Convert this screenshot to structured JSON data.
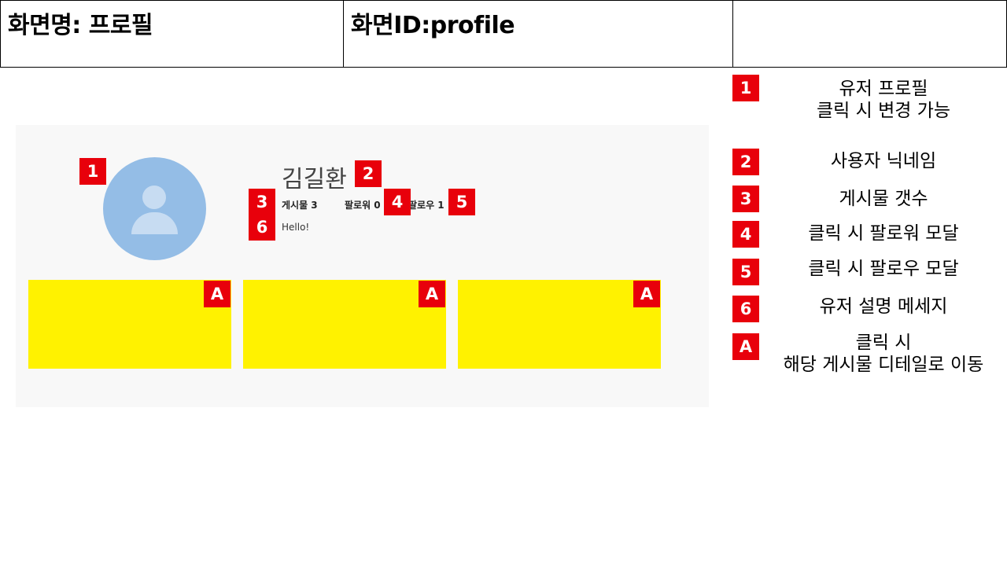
{
  "header": {
    "screen_name": "화면명: 프로필",
    "screen_id": "화면ID:profile",
    "extra": ""
  },
  "profile": {
    "nickname": "김길환",
    "posts_label": "게시물 3",
    "followers_label": "팔로워 0",
    "following_label": "팔로우 1",
    "bio": "Hello!"
  },
  "markers": {
    "m1": "1",
    "m2": "2",
    "m3": "3",
    "m4": "4",
    "m5": "5",
    "m6": "6",
    "mA": "A"
  },
  "legend": [
    {
      "marker": "1",
      "line1": "유저 프로필",
      "line2": "클릭 시 변경 가능"
    },
    {
      "marker": "2",
      "line1": "사용자 닉네임",
      "line2": ""
    },
    {
      "marker": "3",
      "line1": "게시물 갯수",
      "line2": ""
    },
    {
      "marker": "4",
      "line1": "클릭 시 팔로워 모달",
      "line2": ""
    },
    {
      "marker": "5",
      "line1": "클릭 시 팔로우 모달",
      "line2": ""
    },
    {
      "marker": "6",
      "line1": "유저 설명 메세지",
      "line2": ""
    },
    {
      "marker": "A",
      "line1": "클릭 시",
      "line2": "해당 게시물 디테일로 이동"
    }
  ],
  "colors": {
    "badge": "#e8000b",
    "avatar": "#94bde6",
    "post_card": "#fff200",
    "panel": "#f8f8f8"
  }
}
